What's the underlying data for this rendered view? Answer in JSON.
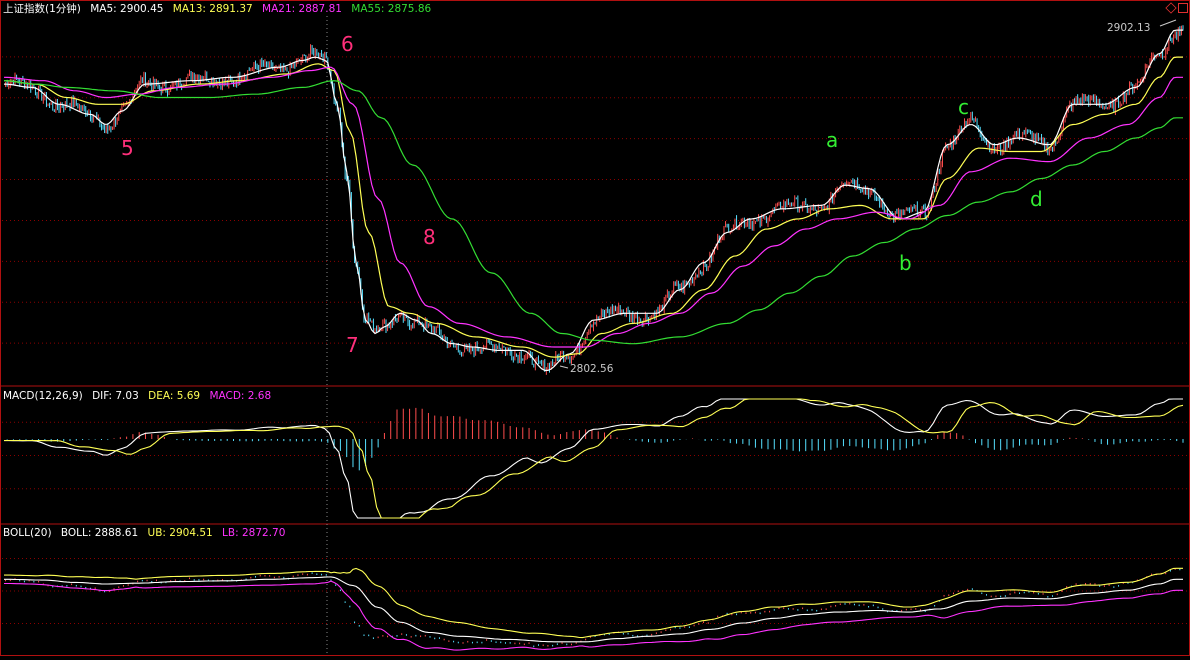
{
  "headers": {
    "main": {
      "title": "上证指数(1分钟)",
      "items": [
        {
          "label": "MA5: 2900.45",
          "color": "#ffffff"
        },
        {
          "label": "MA13: 2891.37",
          "color": "#ffff55"
        },
        {
          "label": "MA21: 2887.81",
          "color": "#ff33ff"
        },
        {
          "label": "MA55: 2875.86",
          "color": "#33dd33"
        }
      ]
    },
    "macd": {
      "title": "MACD(12,26,9)",
      "items": [
        {
          "label": "DIF: 7.03",
          "color": "#ffffff"
        },
        {
          "label": "DEA: 5.69",
          "color": "#ffff55"
        },
        {
          "label": "MACD: 2.68",
          "color": "#ff33ff"
        }
      ]
    },
    "boll": {
      "title": "BOLL(20)",
      "items": [
        {
          "label": "BOLL: 2888.61",
          "color": "#ffffff"
        },
        {
          "label": "UB: 2904.51",
          "color": "#ffff55"
        },
        {
          "label": "LB: 2872.70",
          "color": "#ff33ff"
        }
      ]
    }
  },
  "wave_labels": [
    {
      "text": "5",
      "color": "#ff2f7a"
    },
    {
      "text": "6",
      "color": "#ff2f7a"
    },
    {
      "text": "7",
      "color": "#ff2f7a"
    },
    {
      "text": "8",
      "color": "#ff2f7a"
    },
    {
      "text": "a",
      "color": "#33ee33"
    },
    {
      "text": "b",
      "color": "#33ee33"
    },
    {
      "text": "c",
      "color": "#33ee33"
    },
    {
      "text": "d",
      "color": "#33ee33"
    }
  ],
  "price_annotations": {
    "high": "2902.13",
    "low": "2802.56"
  },
  "colors": {
    "up": "#ff4d4d",
    "down": "#55e0ff",
    "grid": "#8b0000",
    "border": "#b01010"
  },
  "chart_data": {
    "type": "line",
    "x_count": 240,
    "price_range": [
      2800,
      2905
    ],
    "series": [
      {
        "name": "MA5",
        "color": "#ffffff",
        "knots": [
          [
            0,
            2886
          ],
          [
            18,
            2885
          ],
          [
            35,
            2880
          ],
          [
            55,
            2877
          ],
          [
            65,
            2874
          ],
          [
            75,
            2878
          ],
          [
            90,
            2886
          ],
          [
            120,
            2887
          ],
          [
            145,
            2888
          ],
          [
            175,
            2891
          ],
          [
            190,
            2893
          ],
          [
            198,
            2894
          ],
          [
            205,
            2893
          ],
          [
            212,
            2880
          ],
          [
            218,
            2860
          ],
          [
            224,
            2833
          ],
          [
            230,
            2816
          ],
          [
            236,
            2812
          ],
          [
            242,
            2814
          ],
          [
            252,
            2818
          ],
          [
            262,
            2816
          ],
          [
            272,
            2812
          ],
          [
            285,
            2809
          ],
          [
            298,
            2808
          ],
          [
            315,
            2807
          ],
          [
            330,
            2807
          ],
          [
            345,
            2801
          ],
          [
            360,
            2806
          ],
          [
            375,
            2816
          ],
          [
            395,
            2818
          ],
          [
            415,
            2818
          ],
          [
            430,
            2825
          ],
          [
            445,
            2833
          ],
          [
            460,
            2842
          ],
          [
            475,
            2846
          ],
          [
            495,
            2849
          ],
          [
            520,
            2850
          ],
          [
            535,
            2856
          ],
          [
            550,
            2855
          ],
          [
            570,
            2846
          ],
          [
            585,
            2848
          ],
          [
            600,
            2868
          ],
          [
            615,
            2874
          ],
          [
            630,
            2868
          ],
          [
            645,
            2870
          ],
          [
            665,
            2868
          ],
          [
            680,
            2880
          ],
          [
            700,
            2880
          ],
          [
            720,
            2885
          ],
          [
            735,
            2895
          ],
          [
            745,
            2902
          ]
        ]
      },
      {
        "name": "MA13",
        "color": "#ffff55",
        "knots": [
          [
            0,
            2887
          ],
          [
            20,
            2886
          ],
          [
            40,
            2882
          ],
          [
            60,
            2880
          ],
          [
            75,
            2880
          ],
          [
            95,
            2884
          ],
          [
            125,
            2886
          ],
          [
            150,
            2887
          ],
          [
            180,
            2889
          ],
          [
            200,
            2892
          ],
          [
            210,
            2890
          ],
          [
            220,
            2872
          ],
          [
            232,
            2842
          ],
          [
            245,
            2820
          ],
          [
            258,
            2818
          ],
          [
            275,
            2815
          ],
          [
            300,
            2811
          ],
          [
            330,
            2808
          ],
          [
            350,
            2805
          ],
          [
            365,
            2806
          ],
          [
            380,
            2812
          ],
          [
            400,
            2815
          ],
          [
            425,
            2818
          ],
          [
            445,
            2825
          ],
          [
            465,
            2835
          ],
          [
            485,
            2843
          ],
          [
            505,
            2846
          ],
          [
            525,
            2849
          ],
          [
            545,
            2850
          ],
          [
            565,
            2846
          ],
          [
            585,
            2846
          ],
          [
            600,
            2858
          ],
          [
            620,
            2867
          ],
          [
            640,
            2866
          ],
          [
            660,
            2866
          ],
          [
            680,
            2874
          ],
          [
            700,
            2877
          ],
          [
            720,
            2880
          ],
          [
            735,
            2888
          ],
          [
            745,
            2894
          ]
        ]
      },
      {
        "name": "MA21",
        "color": "#ff33ff",
        "knots": [
          [
            0,
            2888
          ],
          [
            25,
            2887
          ],
          [
            45,
            2884
          ],
          [
            65,
            2882
          ],
          [
            85,
            2883
          ],
          [
            110,
            2885
          ],
          [
            140,
            2886
          ],
          [
            170,
            2888
          ],
          [
            195,
            2890
          ],
          [
            208,
            2891
          ],
          [
            222,
            2880
          ],
          [
            238,
            2852
          ],
          [
            252,
            2833
          ],
          [
            270,
            2820
          ],
          [
            290,
            2815
          ],
          [
            320,
            2811
          ],
          [
            350,
            2808
          ],
          [
            370,
            2808
          ],
          [
            390,
            2812
          ],
          [
            410,
            2815
          ],
          [
            430,
            2818
          ],
          [
            450,
            2824
          ],
          [
            470,
            2832
          ],
          [
            490,
            2838
          ],
          [
            510,
            2843
          ],
          [
            530,
            2846
          ],
          [
            555,
            2848
          ],
          [
            575,
            2846
          ],
          [
            595,
            2850
          ],
          [
            615,
            2860
          ],
          [
            640,
            2864
          ],
          [
            665,
            2863
          ],
          [
            690,
            2870
          ],
          [
            715,
            2874
          ],
          [
            735,
            2882
          ],
          [
            745,
            2888
          ]
        ]
      },
      {
        "name": "MA55",
        "color": "#33dd33",
        "knots": [
          [
            0,
            2887
          ],
          [
            20,
            2886
          ],
          [
            40,
            2885
          ],
          [
            70,
            2884
          ],
          [
            100,
            2882
          ],
          [
            130,
            2882
          ],
          [
            160,
            2883
          ],
          [
            190,
            2885
          ],
          [
            210,
            2887
          ],
          [
            225,
            2884
          ],
          [
            240,
            2876
          ],
          [
            260,
            2862
          ],
          [
            285,
            2846
          ],
          [
            310,
            2830
          ],
          [
            335,
            2818
          ],
          [
            355,
            2812
          ],
          [
            375,
            2810
          ],
          [
            400,
            2809
          ],
          [
            430,
            2811
          ],
          [
            460,
            2815
          ],
          [
            480,
            2819
          ],
          [
            500,
            2824
          ],
          [
            520,
            2829
          ],
          [
            540,
            2835
          ],
          [
            560,
            2839
          ],
          [
            580,
            2843
          ],
          [
            600,
            2847
          ],
          [
            620,
            2851
          ],
          [
            640,
            2854
          ],
          [
            660,
            2858
          ],
          [
            680,
            2862
          ],
          [
            700,
            2866
          ],
          [
            720,
            2870
          ],
          [
            735,
            2873
          ],
          [
            745,
            2876
          ]
        ]
      }
    ]
  }
}
